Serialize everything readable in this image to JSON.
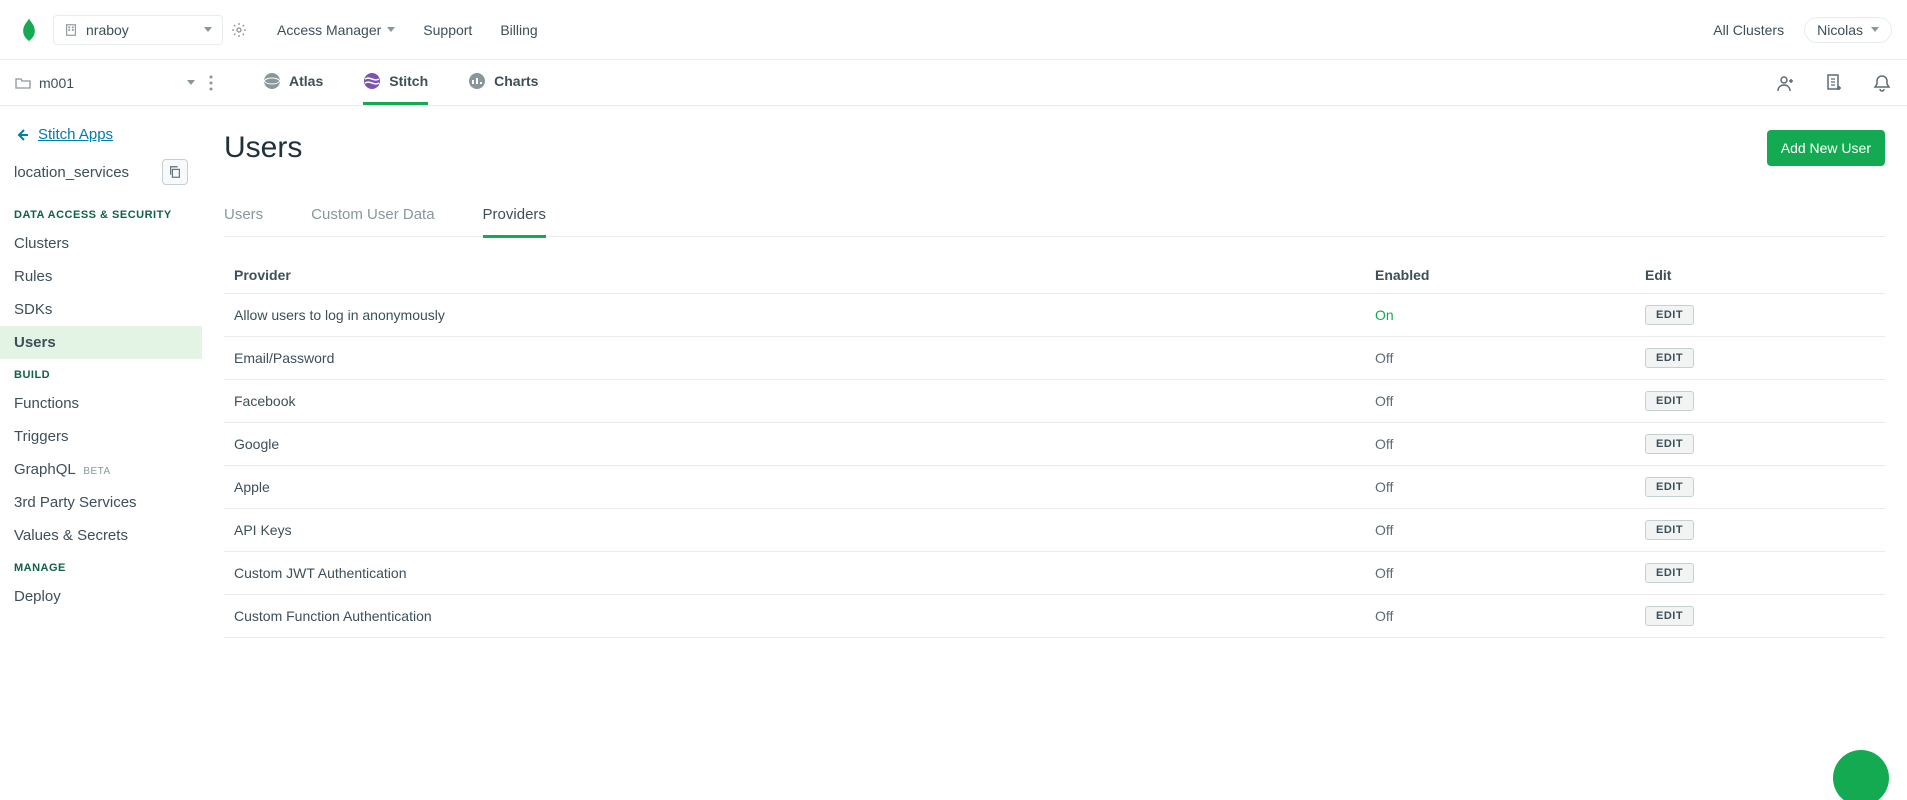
{
  "topbar": {
    "org_name": "nraboy",
    "nav": {
      "access_manager": "Access Manager",
      "support": "Support",
      "billing": "Billing"
    },
    "all_clusters": "All Clusters",
    "user_name": "Nicolas"
  },
  "secondbar": {
    "project_name": "m001",
    "tabs": {
      "atlas": "Atlas",
      "stitch": "Stitch",
      "charts": "Charts"
    }
  },
  "sidebar": {
    "back_link": "Stitch Apps",
    "app_name": "location_services",
    "sections": {
      "data_access": {
        "label": "DATA ACCESS & SECURITY",
        "items": [
          "Clusters",
          "Rules",
          "SDKs",
          "Users"
        ]
      },
      "build": {
        "label": "BUILD",
        "items": [
          "Functions",
          "Triggers",
          "GraphQL",
          "3rd Party Services",
          "Values & Secrets"
        ],
        "graphql_beta": "BETA"
      },
      "manage": {
        "label": "MANAGE",
        "items": [
          "Deploy"
        ]
      }
    }
  },
  "main": {
    "title": "Users",
    "add_button": "Add New User",
    "sub_tabs": [
      "Users",
      "Custom User Data",
      "Providers"
    ],
    "table": {
      "headers": {
        "provider": "Provider",
        "enabled": "Enabled",
        "edit": "Edit"
      },
      "edit_label": "EDIT",
      "rows": [
        {
          "provider": "Allow users to log in anonymously",
          "enabled": "On",
          "on": true
        },
        {
          "provider": "Email/Password",
          "enabled": "Off",
          "on": false
        },
        {
          "provider": "Facebook",
          "enabled": "Off",
          "on": false
        },
        {
          "provider": "Google",
          "enabled": "Off",
          "on": false
        },
        {
          "provider": "Apple",
          "enabled": "Off",
          "on": false
        },
        {
          "provider": "API Keys",
          "enabled": "Off",
          "on": false
        },
        {
          "provider": "Custom JWT Authentication",
          "enabled": "Off",
          "on": false
        },
        {
          "provider": "Custom Function Authentication",
          "enabled": "Off",
          "on": false
        }
      ]
    }
  }
}
